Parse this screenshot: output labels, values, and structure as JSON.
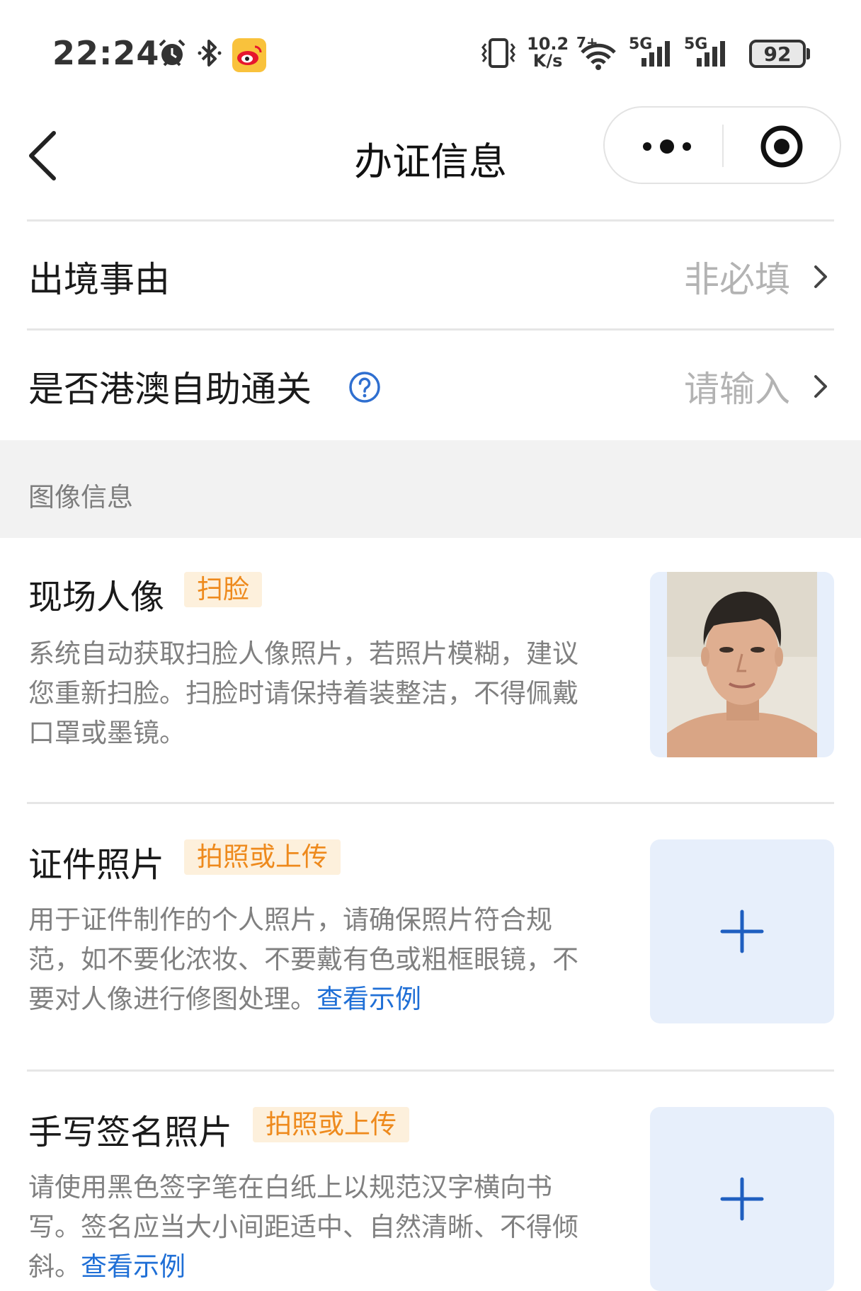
{
  "status_bar": {
    "time": "22:24",
    "net_speed_value": "10.2",
    "net_speed_unit": "K/s",
    "wifi_badge": "7+",
    "signal1_label": "5G",
    "signal2_label": "5G",
    "battery": "92",
    "icons": [
      "alarm-icon",
      "bluetooth-icon",
      "weibo-icon",
      "vibrate-icon",
      "wifi-icon",
      "signal-icon",
      "battery-icon"
    ]
  },
  "nav": {
    "title": "办证信息",
    "icons": [
      "back-icon",
      "more-icon",
      "target-icon"
    ]
  },
  "form": {
    "rows": [
      {
        "label": "出境事由",
        "value": "非必填"
      },
      {
        "label": "是否港澳自助通关",
        "value": "请输入"
      }
    ]
  },
  "section": {
    "title": "图像信息"
  },
  "items": [
    {
      "title": "现场人像",
      "tag": "扫脸",
      "desc": "系统自动获取扫脸人像照片，若照片模糊，建议您重新扫脸。扫脸时请保持着装整洁，不得佩戴口罩或墨镜。"
    },
    {
      "title": "证件照片",
      "tag": "拍照或上传",
      "desc": "用于证件制作的个人照片，请确保照片符合规范，如不要化浓妆、不要戴有色或粗框眼镜，不要对人像进行修图处理。",
      "link": "查看示例"
    },
    {
      "title": "手写签名照片",
      "tag": "拍照或上传",
      "desc": "请使用黑色签字笔在白纸上以规范汉字横向书写。签名应当大小间距适中、自然清晰、不得倾斜。",
      "link": "查看示例"
    }
  ],
  "colors": {
    "accent_blue": "#1f6fd6",
    "tag_orange": "#ee8a1d",
    "tag_bg": "#fdf0dc",
    "upload_bg": "#e7effb"
  }
}
